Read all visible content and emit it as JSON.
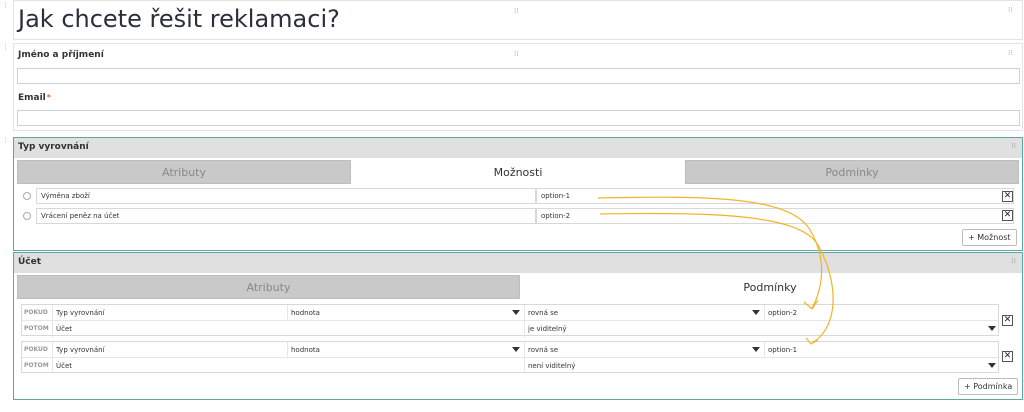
{
  "title": "Jak chcete řešit reklamaci?",
  "fields": {
    "name_label": "Jméno a příjmení",
    "email_label": "Email",
    "email_required_mark": "*"
  },
  "typ_panel": {
    "title": "Typ vyrovnání",
    "tabs": [
      "Atributy",
      "Možnosti",
      "Podmínky"
    ],
    "active_tab": "Možnosti",
    "options": [
      {
        "label": "Výměna zboží",
        "value": "option-1"
      },
      {
        "label": "Vrácení peněz na účet",
        "value": "option-2"
      }
    ],
    "add_button": "+ Možnost"
  },
  "ucet_panel": {
    "title": "Účet",
    "tabs": [
      "Atributy",
      "Podmínky"
    ],
    "active_tab": "Podmínky",
    "conditions": [
      {
        "if_kw": "POKUD",
        "if_field": "Typ vyrovnání",
        "if_attr": "hodnota",
        "if_op": "rovná se",
        "if_value": "option-2",
        "then_kw": "POTOM",
        "then_field": "Účet",
        "then_action": "je viditelný"
      },
      {
        "if_kw": "POKUD",
        "if_field": "Typ vyrovnání",
        "if_attr": "hodnota",
        "if_op": "rovná se",
        "if_value": "option-1",
        "then_kw": "POTOM",
        "then_field": "Účet",
        "then_action": "není viditelný"
      }
    ],
    "add_button": "+ Podmínka"
  },
  "annotation_color": "#f0b429",
  "accent_border": "#5aa8a0"
}
